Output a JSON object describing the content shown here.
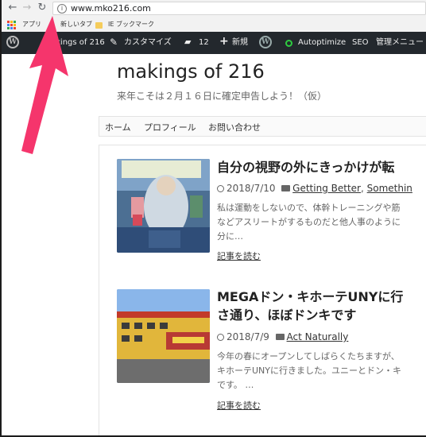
{
  "browser": {
    "url": "www.mko216.com",
    "bookmarks": [
      {
        "label": "アプリ"
      },
      {
        "label": "新しいタブ"
      },
      {
        "label": "IE ブックマーク"
      }
    ]
  },
  "adminbar": {
    "site_name": "akings of 216",
    "customize": "カスタマイズ",
    "comments_count": "12",
    "new": "新規",
    "autoptimize": "Autoptimize",
    "seo": "SEO",
    "admin_menu": "管理メニュー"
  },
  "site": {
    "title": "makings of 216",
    "tagline": "来年こそは２月１６日に確定申告しよう！（仮）"
  },
  "menu": [
    "ホーム",
    "プロフィール",
    "お問い合わせ"
  ],
  "posts": [
    {
      "title": "自分の視野の外にきっかけが転",
      "date": "2018/7/10",
      "categories": [
        "Getting Better",
        "Somethin"
      ],
      "excerpt": [
        "私は運動をしないので、体幹トレーニングや筋",
        "などアスリートがするものだと他人事のように",
        "分に…"
      ],
      "read_more": "記事を読む"
    },
    {
      "title_lines": [
        "MEGAドン・キホーテUNYに行",
        "さ通り、ほぼドンキです"
      ],
      "date": "2018/7/9",
      "categories": [
        "Act Naturally"
      ],
      "excerpt": [
        "今年の春にオープンしてしばらくたちますが、",
        "キホーテUNYに行きました。ユニーとドン・キ",
        "です。 …"
      ],
      "read_more": "記事を読む"
    }
  ],
  "colors": {
    "adminbar_bg": "#23282d",
    "annotation_arrow": "#f5356c",
    "link": "#333333"
  }
}
